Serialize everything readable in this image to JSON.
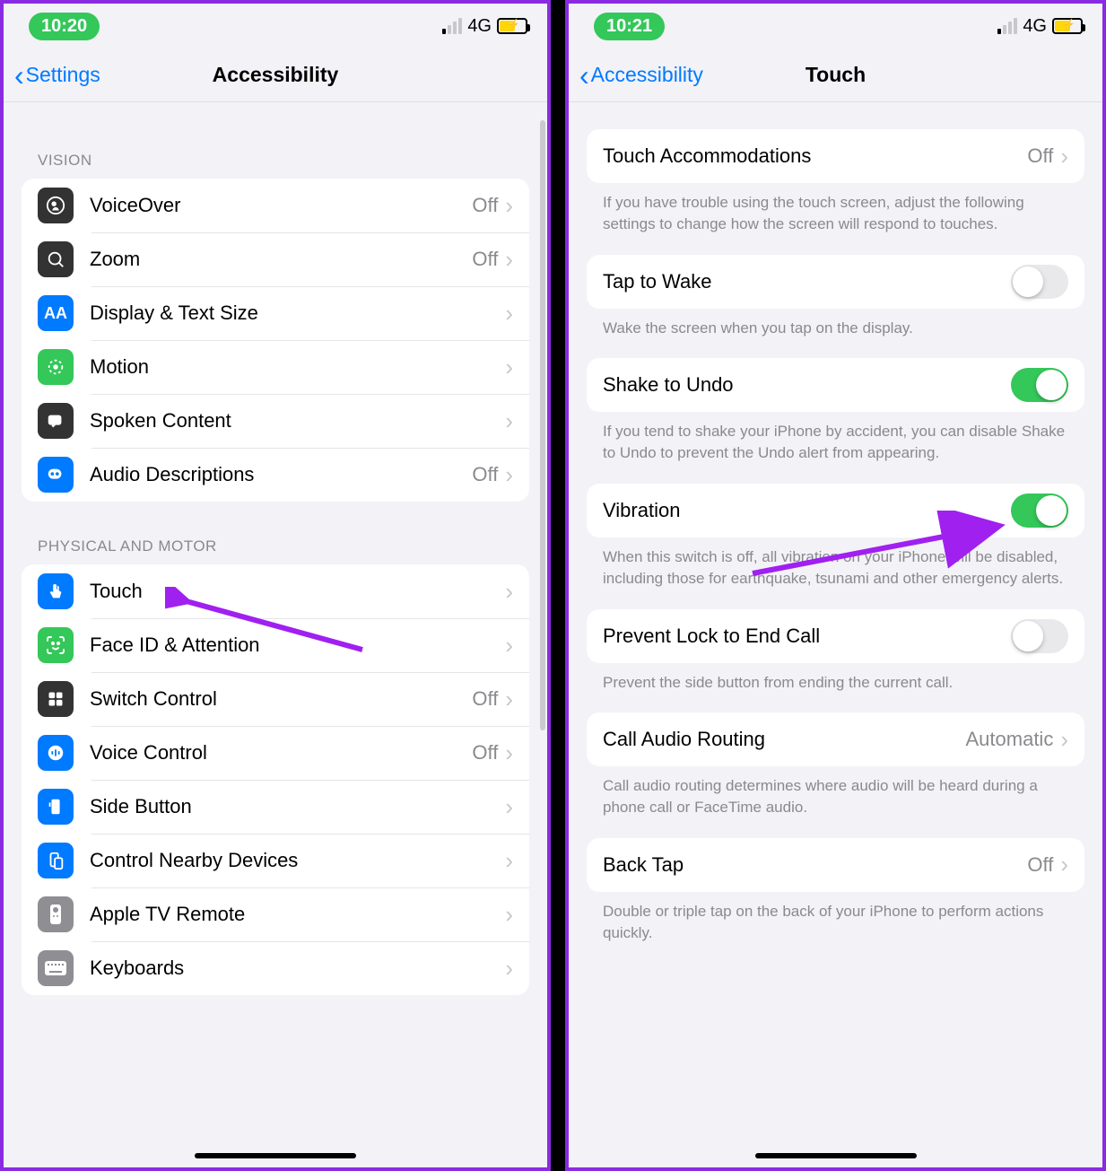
{
  "left": {
    "status": {
      "time": "10:20",
      "network": "4G"
    },
    "nav": {
      "back": "Settings",
      "title": "Accessibility"
    },
    "sections": {
      "vision_header": "VISION",
      "motor_header": "PHYSICAL AND MOTOR"
    },
    "vision": [
      {
        "label": "VoiceOver",
        "value": "Off",
        "icon": "voiceover",
        "color": "#333333"
      },
      {
        "label": "Zoom",
        "value": "Off",
        "icon": "zoom",
        "color": "#333333"
      },
      {
        "label": "Display & Text Size",
        "value": "",
        "icon": "text",
        "color": "#007aff"
      },
      {
        "label": "Motion",
        "value": "",
        "icon": "motion",
        "color": "#34c759"
      },
      {
        "label": "Spoken Content",
        "value": "",
        "icon": "spoken",
        "color": "#333333"
      },
      {
        "label": "Audio Descriptions",
        "value": "Off",
        "icon": "audio",
        "color": "#007aff"
      }
    ],
    "motor": [
      {
        "label": "Touch",
        "value": "",
        "icon": "touch",
        "color": "#007aff"
      },
      {
        "label": "Face ID & Attention",
        "value": "",
        "icon": "face",
        "color": "#34c759"
      },
      {
        "label": "Switch Control",
        "value": "Off",
        "icon": "switch",
        "color": "#333333"
      },
      {
        "label": "Voice Control",
        "value": "Off",
        "icon": "voice",
        "color": "#007aff"
      },
      {
        "label": "Side Button",
        "value": "",
        "icon": "side",
        "color": "#007aff"
      },
      {
        "label": "Control Nearby Devices",
        "value": "",
        "icon": "nearby",
        "color": "#007aff"
      },
      {
        "label": "Apple TV Remote",
        "value": "",
        "icon": "remote",
        "color": "#8e8e93"
      },
      {
        "label": "Keyboards",
        "value": "",
        "icon": "keyboard",
        "color": "#8e8e93"
      }
    ]
  },
  "right": {
    "status": {
      "time": "10:21",
      "network": "4G"
    },
    "nav": {
      "back": "Accessibility",
      "title": "Touch"
    },
    "items": {
      "touch_accom": {
        "label": "Touch Accommodations",
        "value": "Off"
      },
      "touch_accom_footer": "If you have trouble using the touch screen, adjust the following settings to change how the screen will respond to touches.",
      "tap_wake": {
        "label": "Tap to Wake",
        "on": false
      },
      "tap_wake_footer": "Wake the screen when you tap on the display.",
      "shake_undo": {
        "label": "Shake to Undo",
        "on": true
      },
      "shake_undo_footer": "If you tend to shake your iPhone by accident, you can disable Shake to Undo to prevent the Undo alert from appearing.",
      "vibration": {
        "label": "Vibration",
        "on": true
      },
      "vibration_footer": "When this switch is off, all vibration on your iPhone will be disabled, including those for earthquake, tsunami and other emergency alerts.",
      "prevent_lock": {
        "label": "Prevent Lock to End Call",
        "on": false
      },
      "prevent_lock_footer": "Prevent the side button from ending the current call.",
      "call_audio": {
        "label": "Call Audio Routing",
        "value": "Automatic"
      },
      "call_audio_footer": "Call audio routing determines where audio will be heard during a phone call or FaceTime audio.",
      "back_tap": {
        "label": "Back Tap",
        "value": "Off"
      },
      "back_tap_footer": "Double or triple tap on the back of your iPhone to perform actions quickly."
    }
  }
}
